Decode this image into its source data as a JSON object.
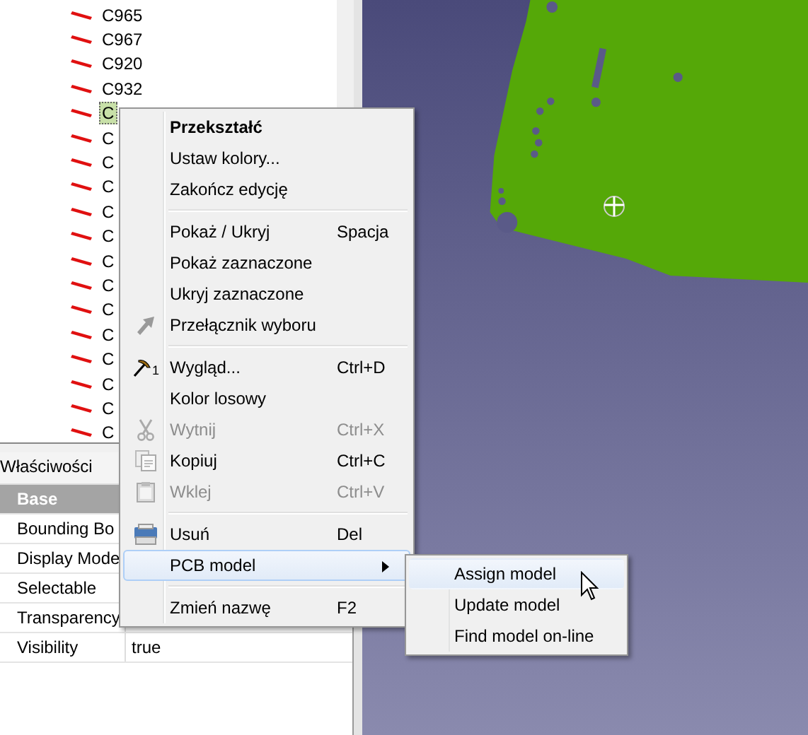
{
  "tree": {
    "items": [
      {
        "label": "C965",
        "selected": false
      },
      {
        "label": "C967",
        "selected": false
      },
      {
        "label": "C920",
        "selected": false
      },
      {
        "label": "C932",
        "selected": false
      },
      {
        "label": "C",
        "selected": true
      },
      {
        "label": "C",
        "selected": false
      },
      {
        "label": "C",
        "selected": false
      },
      {
        "label": "C",
        "selected": false
      },
      {
        "label": "C",
        "selected": false
      },
      {
        "label": "C",
        "selected": false
      },
      {
        "label": "C",
        "selected": false
      },
      {
        "label": "C",
        "selected": false
      },
      {
        "label": "C",
        "selected": false
      },
      {
        "label": "C",
        "selected": false
      },
      {
        "label": "C",
        "selected": false
      },
      {
        "label": "C",
        "selected": false
      },
      {
        "label": "C",
        "selected": false
      },
      {
        "label": "C",
        "selected": false
      }
    ]
  },
  "properties": {
    "title": "Właściwości",
    "rows": [
      {
        "kind": "group",
        "name": "Base"
      },
      {
        "kind": "property",
        "name": "Bounding Bo"
      },
      {
        "kind": "property",
        "name": "Display Mode"
      },
      {
        "kind": "property",
        "name": "Selectable"
      },
      {
        "kind": "property",
        "name": "Transparency"
      },
      {
        "kind": "property",
        "name": "Visibility",
        "value": "true"
      }
    ]
  },
  "context_menu": {
    "items": [
      {
        "kind": "item",
        "label": "Przekształć",
        "bold": true,
        "disabled": false,
        "selected": false
      },
      {
        "kind": "item",
        "label": "Ustaw kolory...",
        "disabled": false,
        "selected": false
      },
      {
        "kind": "item",
        "label": "Zakończ edycję",
        "disabled": false,
        "selected": false
      },
      {
        "kind": "separator"
      },
      {
        "kind": "item",
        "label": "Pokaż / Ukryj",
        "shortcut": "Spacja",
        "disabled": false,
        "selected": false
      },
      {
        "kind": "item",
        "label": "Pokaż zaznaczone",
        "disabled": false,
        "selected": false
      },
      {
        "kind": "item",
        "label": "Ukryj zaznaczone",
        "disabled": false,
        "selected": false
      },
      {
        "kind": "item",
        "label": "Przełącznik wyboru",
        "disabled": false,
        "selected": false
      },
      {
        "kind": "separator"
      },
      {
        "kind": "item",
        "label": "Wygląd...",
        "shortcut": "Ctrl+D",
        "icon_badge": "1",
        "disabled": false,
        "selected": false
      },
      {
        "kind": "item",
        "label": "Kolor losowy",
        "disabled": false,
        "selected": false
      },
      {
        "kind": "item",
        "label": "Wytnij",
        "shortcut": "Ctrl+X",
        "disabled": true,
        "selected": false
      },
      {
        "kind": "item",
        "label": "Kopiuj",
        "shortcut": "Ctrl+C",
        "disabled": false,
        "selected": false
      },
      {
        "kind": "item",
        "label": "Wklej",
        "shortcut": "Ctrl+V",
        "disabled": true,
        "selected": false
      },
      {
        "kind": "separator"
      },
      {
        "kind": "item",
        "label": "Usuń",
        "shortcut": "Del",
        "disabled": false,
        "selected": false
      },
      {
        "kind": "item",
        "label": "PCB model",
        "submenu": true,
        "disabled": false,
        "selected": true
      },
      {
        "kind": "separator"
      },
      {
        "kind": "item",
        "label": "Zmień nazwę",
        "shortcut": "F2",
        "disabled": false,
        "selected": false
      }
    ]
  },
  "submenu": {
    "items": [
      {
        "label": "Assign model",
        "selected": true
      },
      {
        "label": "Update model",
        "selected": false
      },
      {
        "label": "Find model on-line",
        "selected": false
      }
    ]
  }
}
